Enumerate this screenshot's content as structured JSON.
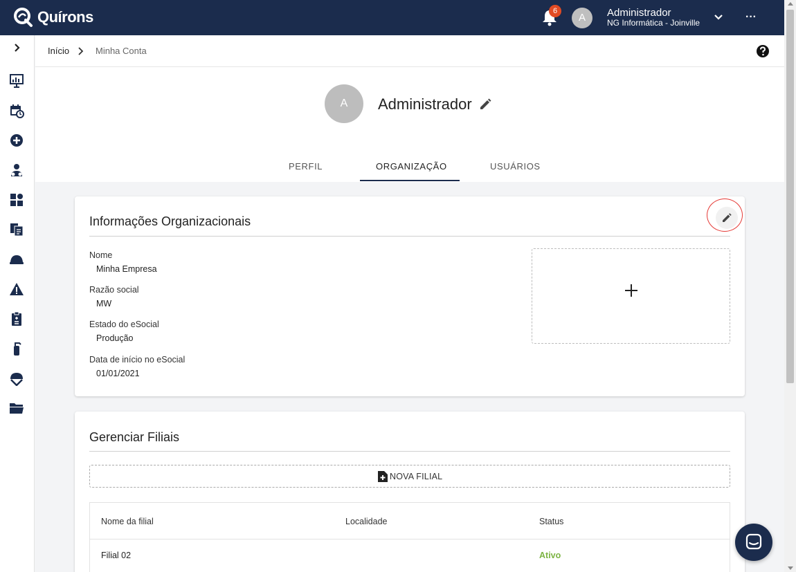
{
  "app": {
    "logo_text": "Quírons"
  },
  "header": {
    "notification_count": "6",
    "avatar_letter": "A",
    "user_name": "Administrador",
    "user_org": "NG Informática - Joinville",
    "more_label": "···"
  },
  "breadcrumb": {
    "home": "Início",
    "current": "Minha Conta"
  },
  "profile": {
    "avatar_letter": "A",
    "name": "Administrador",
    "tabs": [
      {
        "label": "PERFIL",
        "active": false
      },
      {
        "label": "ORGANIZAÇÃO",
        "active": true
      },
      {
        "label": "USUÁRIOS",
        "active": false
      }
    ]
  },
  "org_card": {
    "title": "Informações Organizacionais",
    "fields": [
      {
        "label": "Nome",
        "value": "Minha Empresa"
      },
      {
        "label": "Razão social",
        "value": "MW"
      },
      {
        "label": "Estado do eSocial",
        "value": "Produção"
      },
      {
        "label": "Data de início no eSocial",
        "value": "01/01/2021"
      }
    ],
    "logo_upload_icon": "plus-icon"
  },
  "branches_card": {
    "title": "Gerenciar Filiais",
    "new_button": "NOVA FILIAL",
    "columns": [
      "Nome da filial",
      "Localidade",
      "Status"
    ],
    "rows": [
      {
        "name": "Filial 02",
        "location": "",
        "status": "Ativo"
      }
    ]
  },
  "sidebar_icons": [
    "dashboard-icon",
    "calendar-clock-icon",
    "add-circle-icon",
    "users-icon",
    "puzzle-person-icon",
    "documents-icon",
    "helmet-icon",
    "warning-icon",
    "clipboard-icon",
    "extinguisher-icon",
    "safety-helmet-icon",
    "folder-icon"
  ],
  "colors": {
    "topbar": "#1b2c4d",
    "status_active": "#7cb342",
    "badge": "#e14b24"
  }
}
